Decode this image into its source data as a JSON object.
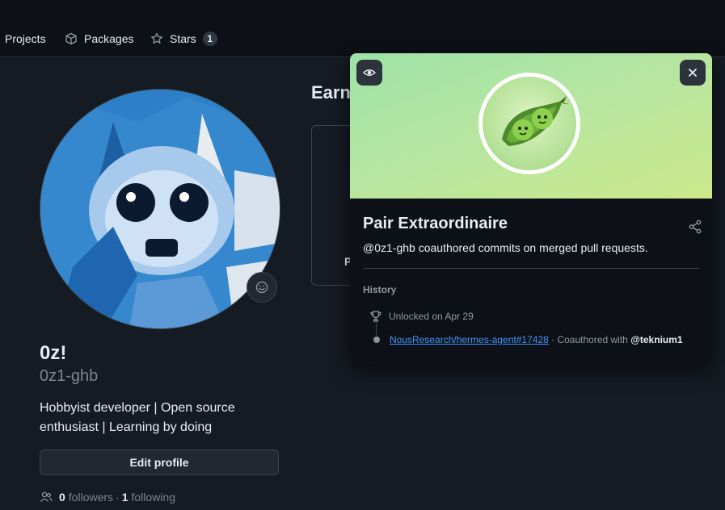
{
  "nav": {
    "items": [
      {
        "label": "Projects",
        "icon": "table-icon"
      },
      {
        "label": "Packages",
        "icon": "package-icon"
      },
      {
        "label": "Stars",
        "icon": "star-icon",
        "count": "1"
      }
    ]
  },
  "profile": {
    "name": "0z!",
    "login": "0z1-ghb",
    "bio": "Hobbyist developer | Open source enthusiast | Learning by doing",
    "edit_label": "Edit profile",
    "followers_count": "0",
    "followers_label": "followers",
    "separator": "·",
    "following_count": "1",
    "following_label": "following"
  },
  "main": {
    "earned_heading": "Earn",
    "card_letter": "P"
  },
  "popover": {
    "title": "Pair Extraordinaire",
    "description": "@0z1-ghb coauthored commits on merged pull requests.",
    "history_label": "History",
    "unlocked_text": "Unlocked on Apr 29",
    "pr_link": "NousResearch/hermes-agent#17428",
    "coauthored_text": " · Coauthored with ",
    "coauthor": "@teknium1",
    "banner_color_start": "#9ee3a8",
    "banner_color_end": "#cbe98a"
  },
  "colors": {
    "background": "#151b23",
    "nav_background": "#0d1117",
    "link": "#4493f8",
    "border": "#3d444d"
  }
}
